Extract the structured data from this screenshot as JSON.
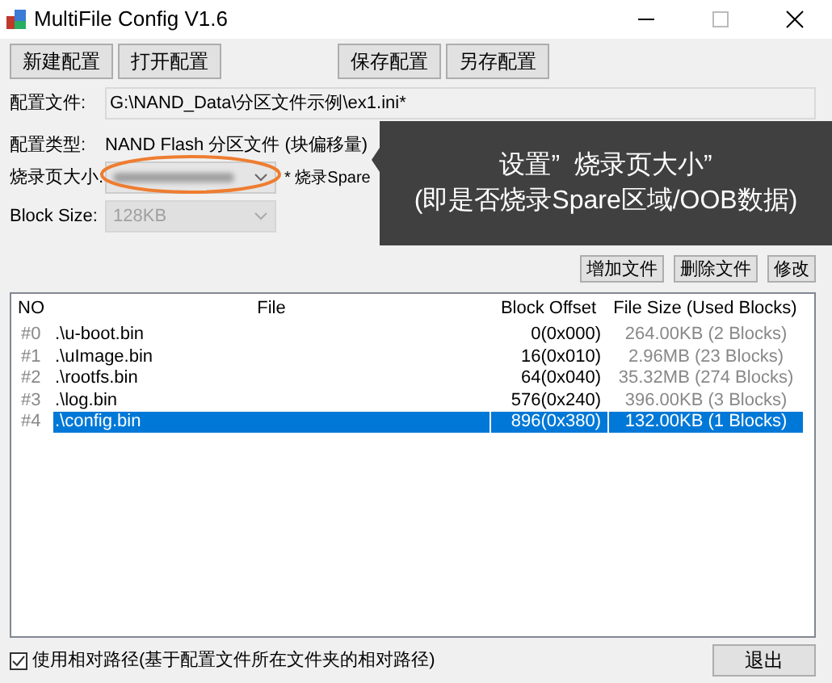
{
  "window": {
    "title": "MultiFile Config V1.6"
  },
  "toolbar": [
    {
      "label": "新建配置"
    },
    {
      "label": "打开配置"
    },
    {
      "label": "保存配置"
    },
    {
      "label": "另存配置"
    }
  ],
  "config_file": {
    "label": "配置文件:",
    "value": "G:\\NAND_Data\\分区文件示例\\ex1.ini*"
  },
  "config_type": {
    "label": "配置类型:",
    "value": "NAND Flash 分区文件 (块偏移量)"
  },
  "page_size": {
    "label": "烧录页大小:",
    "note": "* 烧录Spare"
  },
  "block_size": {
    "label": "Block Size:",
    "value": "128KB",
    "disabled": true
  },
  "file_buttons": [
    {
      "label": "增加文件"
    },
    {
      "label": "删除文件"
    },
    {
      "label": "修改"
    }
  ],
  "table": {
    "columns": [
      "NO",
      "File",
      "Block Offset",
      "File Size (Used Blocks)"
    ],
    "rows": [
      {
        "no": "#0",
        "file": ".\\u-boot.bin",
        "offset": "0(0x000)",
        "size": "264.00KB (2 Blocks)",
        "selected": false
      },
      {
        "no": "#1",
        "file": ".\\uImage.bin",
        "offset": "16(0x010)",
        "size": "2.96MB (23 Blocks)",
        "selected": false
      },
      {
        "no": "#2",
        "file": ".\\rootfs.bin",
        "offset": "64(0x040)",
        "size": "35.32MB (274 Blocks)",
        "selected": false
      },
      {
        "no": "#3",
        "file": ".\\log.bin",
        "offset": "576(0x240)",
        "size": "396.00KB (3 Blocks)",
        "selected": false
      },
      {
        "no": "#4",
        "file": ".\\config.bin",
        "offset": "896(0x380)",
        "size": "132.00KB (1 Blocks)",
        "selected": true
      }
    ]
  },
  "relative_path": {
    "label": "使用相对路径(基于配置文件所在文件夹的相对路径)",
    "checked": true
  },
  "exit_button": {
    "label": "退出"
  },
  "callout": {
    "lines": [
      "设置”  烧录页大小”",
      "(即是否烧录Spare区域/OOB数据)"
    ]
  }
}
